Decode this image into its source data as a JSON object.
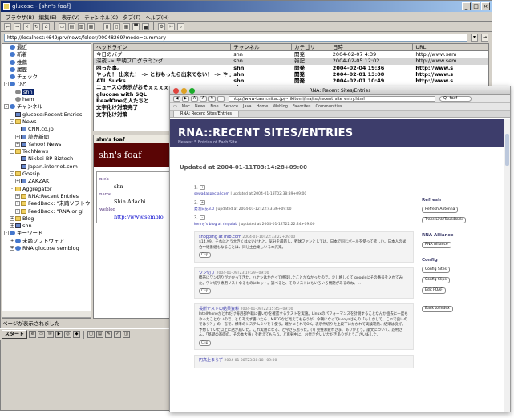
{
  "win1": {
    "title": "glucose - [shn's foaf]",
    "menu": [
      "ブラウザ(B)",
      "編集(E)",
      "表示(V)",
      "チャンネル(C)",
      "タブ(T)",
      "ヘルプ(H)"
    ],
    "address": "http://localhost:4649/prv/news/folder/00C48269?mode=summary",
    "tree": [
      {
        "label": "最近",
        "level": 1,
        "icon": "clock"
      },
      {
        "label": "新着",
        "level": 1,
        "icon": "dot"
      },
      {
        "label": "推薦",
        "level": 1,
        "icon": "dot"
      },
      {
        "label": "履歴",
        "level": 1,
        "icon": "dot"
      },
      {
        "label": "チェック",
        "level": 1,
        "icon": "dot"
      },
      {
        "label": "ひと",
        "level": 0,
        "icon": "dot",
        "expand": "-"
      },
      {
        "label": "shn",
        "level": 2,
        "icon": "person",
        "selected": true
      },
      {
        "label": "ham",
        "level": 2,
        "icon": "person"
      },
      {
        "label": "チャンネル",
        "level": 0,
        "icon": "dot",
        "expand": "-"
      },
      {
        "label": "glucose:Recent Entries",
        "level": 2,
        "icon": "feed"
      },
      {
        "label": "News",
        "level": 1,
        "icon": "folder",
        "expand": "-"
      },
      {
        "label": "CNN.co.jp",
        "level": 3,
        "icon": "feed"
      },
      {
        "label": "読売新聞",
        "level": 2,
        "icon": "feed",
        "expand": "+"
      },
      {
        "label": "Yahoo! News",
        "level": 2,
        "icon": "feed",
        "expand": "+"
      },
      {
        "label": "TechNews",
        "level": 1,
        "icon": "folder",
        "expand": "-"
      },
      {
        "label": "Nikkei BP Biztech",
        "level": 3,
        "icon": "feed"
      },
      {
        "label": "Japan.internet.com",
        "level": 3,
        "icon": "feed"
      },
      {
        "label": "Gossip",
        "level": 1,
        "icon": "folder",
        "expand": "-"
      },
      {
        "label": "ZAKZAK",
        "level": 2,
        "icon": "feed",
        "expand": "+"
      },
      {
        "label": "Aggregator",
        "level": 1,
        "icon": "folder",
        "expand": "-"
      },
      {
        "label": "RNA:Recent Entries",
        "level": 2,
        "icon": "folder",
        "expand": "+"
      },
      {
        "label": "FeedBack: \"未踏ソフトウ",
        "level": 2,
        "icon": "folder",
        "expand": "+"
      },
      {
        "label": "FeedBack: \"RNA or gl",
        "level": 2,
        "icon": "folder",
        "expand": "+"
      },
      {
        "label": "Blog",
        "level": 1,
        "icon": "folder",
        "expand": "+"
      },
      {
        "label": "shn",
        "level": 1,
        "icon": "feed",
        "expand": "+"
      },
      {
        "label": "キーワード",
        "level": 0,
        "icon": "dot",
        "expand": "-"
      },
      {
        "label": "未踏ソフトウェア",
        "level": 1,
        "icon": "dot",
        "expand": "+"
      },
      {
        "label": "RNA glucose semblog",
        "level": 1,
        "icon": "dot",
        "expand": "+"
      }
    ],
    "list": {
      "columns": [
        "ヘッドライン",
        "チャンネル",
        "カテゴリ",
        "日時",
        "URL"
      ],
      "rows": [
        {
          "cells": [
            "今日のバグ",
            "shn",
            "開発",
            "2004-02-07  4:39",
            "http://www.sem"
          ],
          "bold": false,
          "sel": false
        },
        {
          "cells": [
            "深夜 -> 早朝プログラミング",
            "shn",
            "雑記",
            "2004-02-05 12:02",
            "http://www.sem"
          ],
          "bold": false,
          "sel": true
        },
        {
          "cells": [
            "困った事。",
            "shn",
            "開発",
            "2004-02-04 19:36",
            "http://www.s"
          ],
          "bold": true,
          "sel": false
        },
        {
          "cells": [
            "やった！ 出来た！ -> とおもったら出来てない！ -> やった出来た！",
            "shn",
            "開発",
            "2004-02-01 13:08",
            "http://www.s"
          ],
          "bold": true,
          "sel": false
        },
        {
          "cells": [
            "ATL Sucks",
            "shn",
            "開発",
            "2004-02-01 10:49",
            "http://www.s"
          ],
          "bold": true,
          "sel": false
        },
        {
          "cells": [
            "ニュースの表示がおそぇぇぇぇ",
            "shn",
            "",
            "",
            ""
          ],
          "bold": true,
          "sel": false
        },
        {
          "cells": [
            "glucose with SQL",
            "",
            "",
            "",
            ""
          ],
          "bold": true,
          "sel": false
        },
        {
          "cells": [
            "ReadOneの人たちと",
            "",
            "",
            "",
            ""
          ],
          "bold": true,
          "sel": false
        },
        {
          "cells": [
            "文字化け対策完了",
            "",
            "",
            "",
            ""
          ],
          "bold": true,
          "sel": false
        },
        {
          "cells": [
            "文字化け対策",
            "",
            "",
            "",
            ""
          ],
          "bold": true,
          "sel": false
        }
      ]
    },
    "viewer": {
      "tab": "shn's foaf",
      "heading": "shn's foaf",
      "label_nick": "nick",
      "nick": "shn",
      "label_name": "name",
      "name": "Shin Adachi",
      "label_weblog": "weblog",
      "weblog": "http://www.semblo"
    },
    "status": "ページが表示されました",
    "taskbar": {
      "start": "スタート"
    }
  },
  "win2": {
    "title": "RNA: Recent Sites/Entries",
    "url": "http://www-kasm.nii.ac.jp/~rikitomi/rna/rss/recent_site_entry.html",
    "search": "Q- foaf",
    "bookmarks": [
      "Mac",
      "News",
      "Fine",
      "Service",
      "Java",
      "Home",
      "Weblog",
      "Favorites",
      "Communities"
    ],
    "tab": "RNA: Recent Sites/Entries",
    "page": {
      "title": "RNA::RECENT SITES/ENTRIES",
      "subtitle": "Newest 5 Entries of Each Site",
      "updated": "Updated at 2004-01-11T03:14:28+09:00",
      "entries": [
        {
          "num": "1.",
          "pill": "+",
          "site": "sewadaspecial.com",
          "meta": "| updated at 2004-01-13T02:38:39+09:00"
        },
        {
          "num": "2.",
          "pill": "+",
          "site": "発泡日記3.0",
          "meta": "| updated at 2004-01-12T22:43:36+09:00"
        },
        {
          "num": "3.",
          "pill": "-",
          "site": "kenny's blog at ringolab",
          "meta": "| updated at 2004-01-12T22:22:24+09:00"
        }
      ],
      "cards": [
        {
          "title": "shopping at mib.com",
          "date": "2004-01-10T22:33:22+09:00",
          "body": "$14.99。それはどう大きくはないけれど、気分を最新し、野球ファンとしては、日本で同じボールを使って欲しい。日本人の試合中継番組もなることは、同じ土台乗しいる本光楽。",
          "clip": "Clip"
        },
        {
          "title": "ワン切り",
          "date": "2004-01-09T23:19:29+09:00",
          "body": "携帯にワン切りがかかってきた。ハナシはかかって相談したことがなかったので、少し嬉しくて googleにその番号を入れてみた。ワン切り専用リストなるものにヒット。調べると、そのリストにもいろいろ問題があるのね。...",
          "clip": "Clip"
        },
        {
          "title": "長所テストの結果資料",
          "date": "2004-01-09T22:15:45+09:00",
          "body": "IntelPhoneがどれだけ毎月部件聴に書いかを確認するテストを実施。Linuxのパフォーマンスを計測することなんか過去に一度もやったことないので、とりあえず書いたら、MRTGなど見えてもらうが、今朝になってk-soyaさんの「もしかして、これで良いのではう？」の一言で、標準のシステムミツをそ使う。確かにそれでOK。表示件切りた上段下にかかれて実験範熱、結果は良好。予想していた以上に話が届いた。これ実用になる、と今さら思った。(?) 完璧お疲れさま、ありがとう。論文について、忍村さん、「基礎の基礎の、その本大事」を教えてもらう。ど真剣中に、お付き合いいただきありがとうございました。",
          "clip": "Clip"
        },
        {
          "title": "円高止まらず",
          "date": "2004-01-08T23:38:18+09:00",
          "body": "",
          "clip": ""
        }
      ]
    },
    "sidebar": {
      "refresh_heading": "Refresh",
      "refresh_buttons": [
        "Refresh Antenna",
        "Trace Link/TrackBack"
      ],
      "alliance_heading": "RNA Alliance",
      "alliance_buttons": [
        "RNA Alliance"
      ],
      "config_heading": "Config",
      "config_buttons": [
        "Config Sites",
        "Config Clips",
        "Edit FOAF"
      ],
      "back_button": "Back to Index"
    }
  },
  "colors": {
    "xp_title_start": "#0a246a",
    "foaf_header": "#5a0505",
    "rna_header": "#3d3d6b",
    "link": "#3333aa"
  }
}
